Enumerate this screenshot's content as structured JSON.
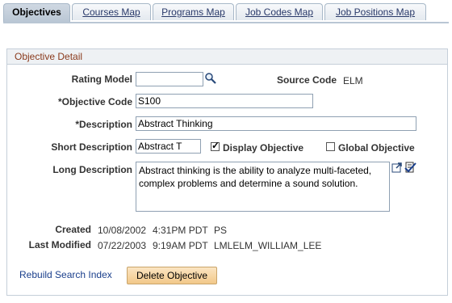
{
  "tabs": [
    {
      "label": "Objectives",
      "active": true
    },
    {
      "label": "Courses Map",
      "active": false
    },
    {
      "label": "Programs Map",
      "active": false
    },
    {
      "label": "Job Codes Map",
      "active": false
    },
    {
      "label": "Job Positions Map",
      "active": false
    }
  ],
  "group": {
    "title": "Objective Detail"
  },
  "form": {
    "rating_model": {
      "label": "Rating Model",
      "value": ""
    },
    "source_code": {
      "label": "Source Code",
      "value": "ELM"
    },
    "objective_code": {
      "label": "*Objective Code",
      "value": "S100"
    },
    "description": {
      "label": "*Description",
      "value": "Abstract Thinking"
    },
    "short_description": {
      "label": "Short Description",
      "value": "Abstract T"
    },
    "display_objective": {
      "label": "Display Objective",
      "checked": true
    },
    "global_objective": {
      "label": "Global Objective",
      "checked": false
    },
    "long_description": {
      "label": "Long Description",
      "value": "Abstract thinking is the ability to analyze multi-faceted, complex problems and determine a sound solution."
    }
  },
  "audit": {
    "created": {
      "label": "Created",
      "date": "10/08/2002",
      "time": "4:31PM PDT",
      "user": "PS"
    },
    "last_modified": {
      "label": "Last Modified",
      "date": "07/22/2003",
      "time": "9:19AM PDT",
      "user": "LMLELM_WILLIAM_LEE"
    }
  },
  "actions": {
    "rebuild_link": "Rebuild Search Index",
    "delete_button": "Delete Objective"
  },
  "colors": {
    "group_title": "#8a3a1c",
    "link": "#1a3f8c",
    "button_bg": "#f2c889"
  }
}
